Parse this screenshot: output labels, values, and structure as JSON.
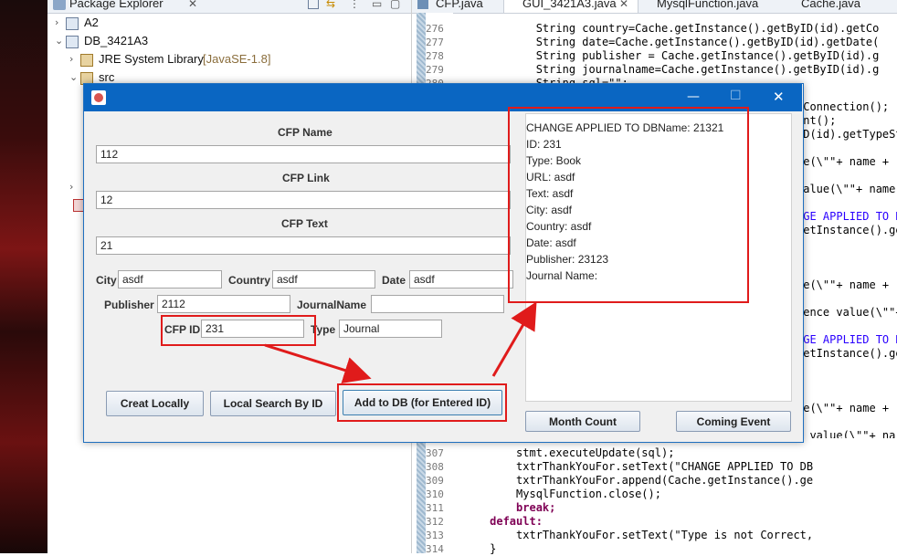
{
  "package_explorer": {
    "tab_label": "Package Explorer",
    "items": [
      "A2",
      "DB_3421A3",
      "JRE System Library",
      "[JavaSE-1.8]",
      "src"
    ]
  },
  "editor": {
    "tabs": [
      "CFP.java",
      "GUI_3421A3.java",
      "MysqlFunction.java",
      "Cache.java"
    ],
    "top_lines": [
      {
        "num": "276",
        "code": "            String country=Cache.getInstance().getByID(id).getCo"
      },
      {
        "num": "277",
        "code": "            String date=Cache.getInstance().getByID(id).getDate("
      },
      {
        "num": "278",
        "code": "            String publisher = Cache.getInstance().getByID(id).g"
      },
      {
        "num": "279",
        "code": "            String journalname=Cache.getInstance().getByID(id).g"
      },
      {
        "num": "280",
        "code": "            String sql=\"\";"
      }
    ],
    "right_fragments": [
      "tConnection();",
      "ent();",
      "ID(id).getTypeSt",
      "le(\\\"\"+ name + \"\\",
      "value(\\\"\"+ name",
      "NGE APPLIED TO DE",
      "getInstance().ge",
      "le(\\\"\"+ name + \"\\",
      "rence value(\\\"\"+",
      "NGE APPLIED TO DB",
      "getInstance().ge",
      "le(\\\"\"+ name + \"\\",
      "l value(\\\"\"+ na"
    ],
    "bottom_lines": [
      {
        "num": "307",
        "code": "         stmt.executeUpdate(sql);"
      },
      {
        "num": "308",
        "code": "         txtrThankYouFor.setText(\"CHANGE APPLIED TO DB"
      },
      {
        "num": "309",
        "code": "         txtrThankYouFor.append(Cache.getInstance().ge"
      },
      {
        "num": "310",
        "code": "         MysqlFunction.close();"
      },
      {
        "num": "311",
        "code": "         break;"
      },
      {
        "num": "312",
        "code": "     default:"
      },
      {
        "num": "313",
        "code": "         txtrThankYouFor.setText(\"Type is not Correct,"
      },
      {
        "num": "314",
        "code": "     }"
      }
    ]
  },
  "dialog": {
    "title_controls": {
      "minimize": "—",
      "maximize": "☐",
      "close": "✕"
    },
    "cfp_name_label": "CFP Name",
    "cfp_name_value": "112",
    "cfp_link_label": "CFP Link",
    "cfp_link_value": "12",
    "cfp_text_label": "CFP Text",
    "cfp_text_value": "21",
    "city_label": "City",
    "city_value": "asdf",
    "country_label": "Country",
    "country_value": "asdf",
    "date_label": "Date",
    "date_value": "asdf",
    "publisher_label": "Publisher",
    "publisher_value": "2112",
    "journalname_label": "JournalName",
    "journalname_value": "",
    "cfp_id_label": "CFP ID",
    "cfp_id_value": "231",
    "type_label": "Type",
    "type_value": "Journal",
    "buttons": {
      "creat_locally": "Creat Locally",
      "local_search": "Local Search By ID",
      "add_to_db": "Add to DB (for Entered ID)",
      "month_count": "Month Count",
      "coming_event": "Coming Event"
    },
    "result_lines": [
      "CHANGE APPLIED TO DBName: 21321",
      "ID: 231",
      "Type: Book",
      "URL: asdf",
      "Text: asdf",
      "City: asdf",
      "Country: asdf",
      "Date: asdf",
      "Publisher: 23123",
      "Journal Name:"
    ]
  },
  "colors": {
    "titlebar": "#0a66c2",
    "annotation": "#e01b1b"
  }
}
